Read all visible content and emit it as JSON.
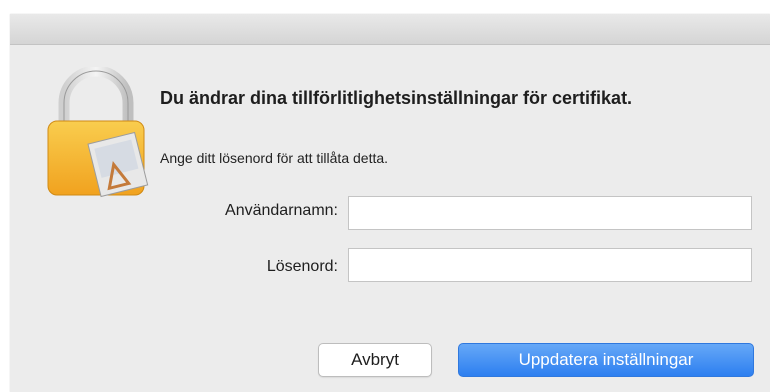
{
  "dialog": {
    "heading": "Du ändrar dina tillförlitlighetsinställningar för certifikat.",
    "subtext": "Ange ditt lösenord för att tillåta detta.",
    "icon": "lock-with-certificate-icon"
  },
  "form": {
    "username_label": "Användarnamn:",
    "username_value": "",
    "password_label": "Lösenord:",
    "password_value": ""
  },
  "buttons": {
    "cancel_label": "Avbryt",
    "primary_label": "Uppdatera inställningar"
  },
  "colors": {
    "accent": "#3b8ef5",
    "lock_body": "#f5b93a"
  }
}
